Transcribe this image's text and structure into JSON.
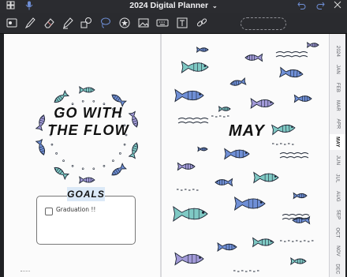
{
  "titlebar": {
    "title": "2024 Digital Planner",
    "title_chevron": "⌄",
    "left_icons": [
      "notebook-grid-icon",
      "microphone-icon"
    ],
    "right_icons": [
      "undo-icon",
      "redo-icon",
      "close-icon"
    ]
  },
  "toolbar": {
    "tools": [
      "scan-icon",
      "pen-icon",
      "eraser-icon",
      "highlighter-icon",
      "shapes-icon",
      "lasso-icon",
      "sticker-icon",
      "image-icon",
      "keyboard-icon",
      "text-icon",
      "link-icon"
    ]
  },
  "left_page": {
    "wreath_line1": "GO WITH",
    "wreath_line2": "THE FLOW",
    "goals_label": "GOALS",
    "goals": [
      {
        "text": "Graduation !!",
        "checked": false
      }
    ]
  },
  "right_page": {
    "month_title": "MAY"
  },
  "month_tabs": {
    "items": [
      "2024",
      "JAN",
      "FEB",
      "MAR",
      "APR",
      "MAY",
      "JUN",
      "JUL",
      "AUG",
      "SEP",
      "OCT",
      "NOV",
      "DEC"
    ],
    "active": "MAY"
  },
  "colors": {
    "accent_teal": "#7fc9c4",
    "accent_blue": "#6f8fd6",
    "accent_purple": "#a29ad8",
    "goals_tag": "#dbe9f7"
  }
}
